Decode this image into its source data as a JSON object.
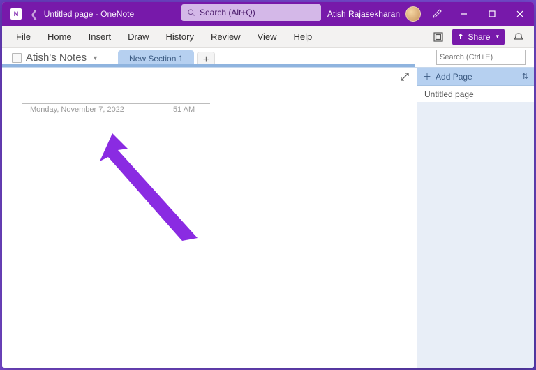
{
  "titlebar": {
    "title": "Untitled page  -  OneNote",
    "app_abbr": "N",
    "search_placeholder": "Search (Alt+Q)",
    "user_name": "Atish Rajasekharan"
  },
  "menubar": {
    "items": [
      "File",
      "Home",
      "Insert",
      "Draw",
      "History",
      "Review",
      "View",
      "Help"
    ],
    "share_label": "Share"
  },
  "notebook": {
    "name": "Atish's Notes",
    "section_tab": "New Section 1",
    "page_search_placeholder": "Search (Ctrl+E)"
  },
  "pagepane": {
    "add_label": "Add Page",
    "pages": [
      "Untitled page"
    ]
  },
  "note": {
    "date": "Monday, November 7, 2022",
    "time": "51 AM"
  },
  "colors": {
    "accent": "#7719AA",
    "section_blue": "#b6d0f0",
    "annotation": "#8a2be2"
  }
}
